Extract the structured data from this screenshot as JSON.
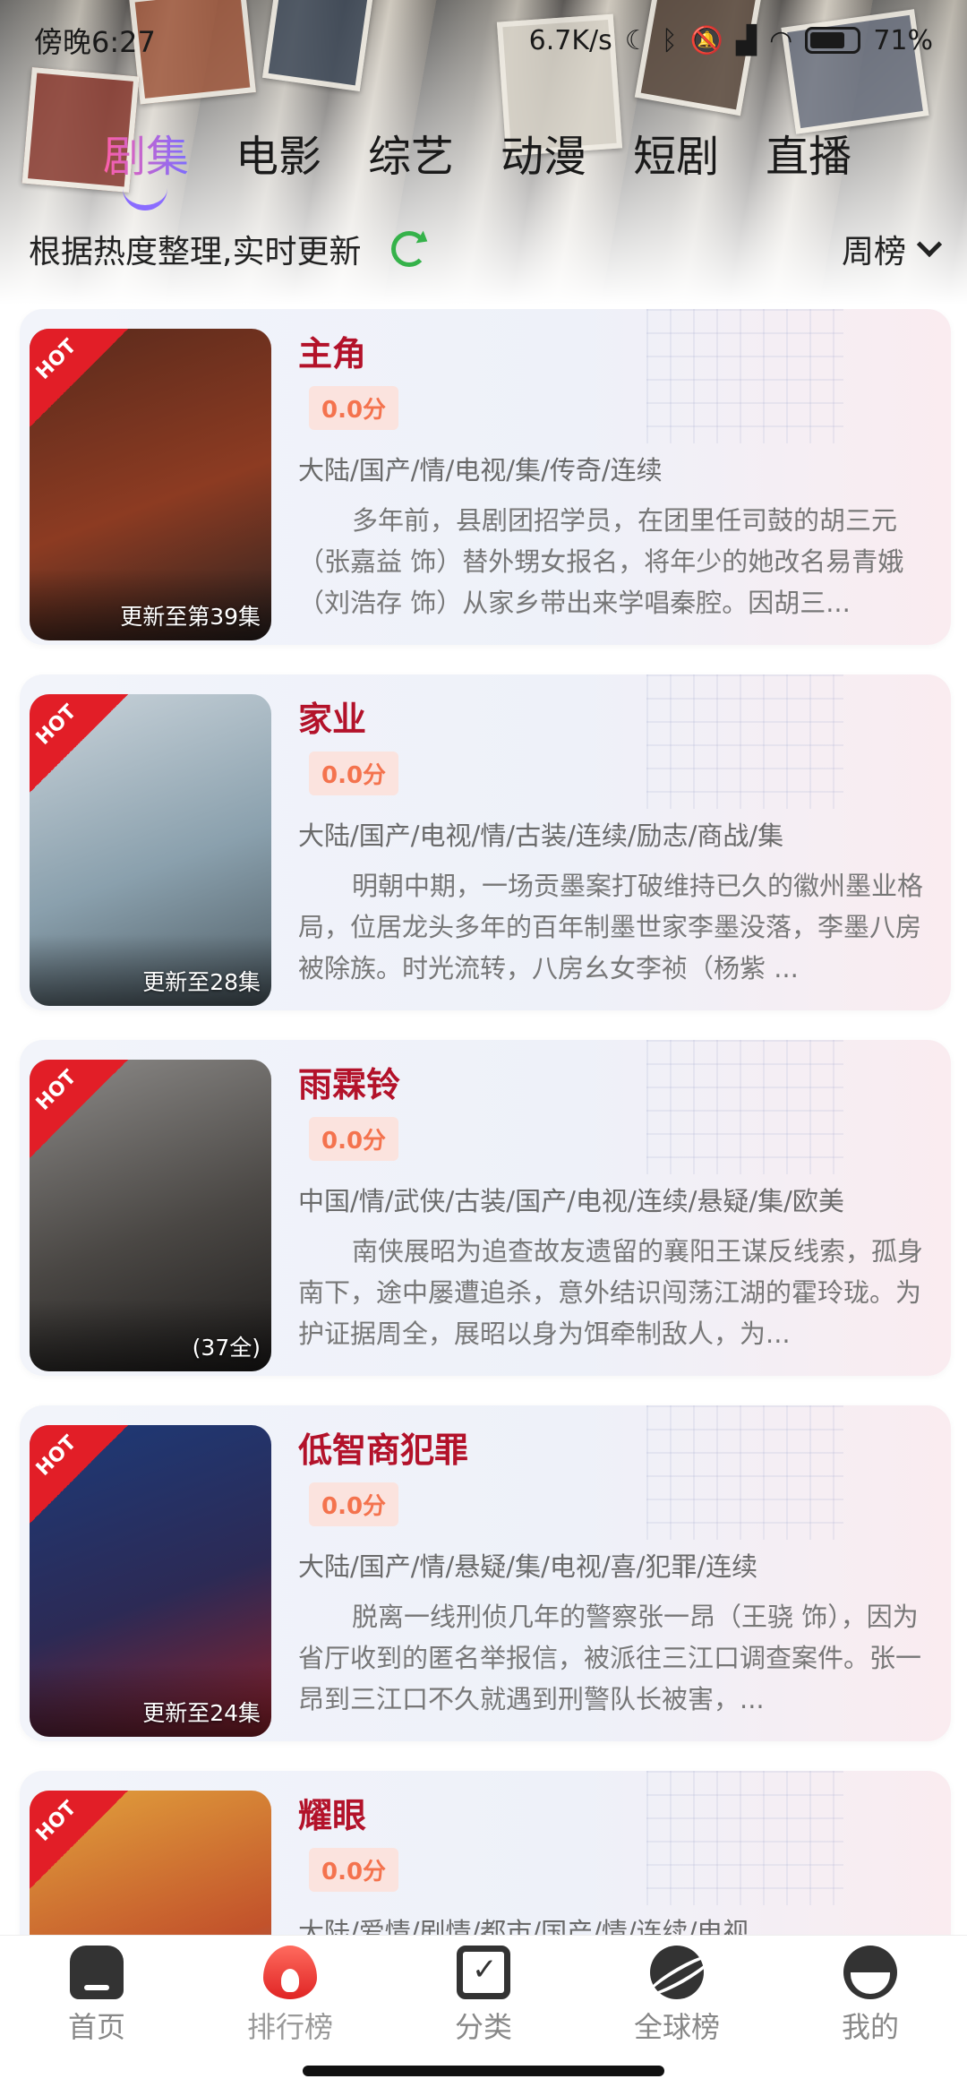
{
  "status_bar": {
    "time": "傍晚6:27",
    "speed": "6.7K/s",
    "battery": "71%"
  },
  "top_tabs": [
    {
      "label": "剧集",
      "active": true
    },
    {
      "label": "电影",
      "active": false
    },
    {
      "label": "综艺",
      "active": false
    },
    {
      "label": "动漫",
      "active": false
    },
    {
      "label": "短剧",
      "active": false
    },
    {
      "label": "直播",
      "active": false
    }
  ],
  "sub_header": {
    "title": "根据热度整理,实时更新",
    "rank_select": "周榜"
  },
  "items": [
    {
      "title": "主角",
      "score": "0.0分",
      "tags": "大陆/国产/情/电视/集/传奇/连续",
      "desc": "多年前，县剧团招学员，在团里任司鼓的胡三元（张嘉益 饰）替外甥女报名，将年少的她改名易青娥（刘浩存 饰）从家乡带出来学唱秦腔。因胡三...",
      "badge": "HOT",
      "update": "更新至第39集",
      "poster_colors": [
        "#5a2a1c",
        "#8c3b22",
        "#2b2220"
      ]
    },
    {
      "title": "家业",
      "score": "0.0分",
      "tags": "大陆/国产/电视/情/古装/连续/励志/商战/集",
      "desc": "明朝中期，一场贡墨案打破维持已久的徽州墨业格局，位居龙头多年的百年制墨世家李墨没落，李墨八房被除族。时光流转，八房幺女李祯（杨紫 ...",
      "badge": "HOT",
      "update": "更新至28集",
      "poster_colors": [
        "#c9d3da",
        "#8aa0ad",
        "#4d5b63"
      ]
    },
    {
      "title": "雨霖铃",
      "score": "0.0分",
      "tags": "中国/情/武侠/古装/国产/电视/连续/悬疑/集/欧美",
      "desc": "南侠展昭为追查故友遗留的襄阳王谋反线索，孤身南下，途中屡遭追杀，意外结识闯荡江湖的霍玲珑。为护证据周全，展昭以身为饵牵制敌人，为...",
      "badge": "HOT",
      "update": "(37全)",
      "poster_colors": [
        "#8c8a88",
        "#4a4744",
        "#1e1c1b"
      ]
    },
    {
      "title": "低智商犯罪",
      "score": "0.0分",
      "tags": "大陆/国产/情/悬疑/集/电视/喜/犯罪/连续",
      "desc": "脱离一线刑侦几年的警察张一昂（王骁 饰），因为省厅收到的匿名举报信，被派往三江口调查案件。张一昂到三江口不久就遇到刑警队长被害，...",
      "badge": "HOT",
      "update": "更新至24集",
      "poster_colors": [
        "#1d3a78",
        "#2c2a55",
        "#8b1f28"
      ]
    },
    {
      "title": "耀眼",
      "score": "0.0分",
      "tags": "大陆/爱情/剧情/都市/国产/情/连续/电视",
      "desc": "",
      "badge": "HOT",
      "update": "",
      "poster_colors": [
        "#e2a23c",
        "#c2522b",
        "#3a6aa6"
      ]
    }
  ],
  "bottom_nav": [
    {
      "label": "首页",
      "icon": "home-icon",
      "active": false
    },
    {
      "label": "排行榜",
      "icon": "fire-icon",
      "active": true
    },
    {
      "label": "分类",
      "icon": "calendar-icon",
      "active": false
    },
    {
      "label": "全球榜",
      "icon": "planet-icon",
      "active": false
    },
    {
      "label": "我的",
      "icon": "profile-icon",
      "active": false
    }
  ],
  "colors": {
    "accent": "#b3122a",
    "score_bg": "#fbe3de",
    "score_text": "#f4734e",
    "hot_badge": "#e21e27",
    "refresh": "#35b24a"
  }
}
